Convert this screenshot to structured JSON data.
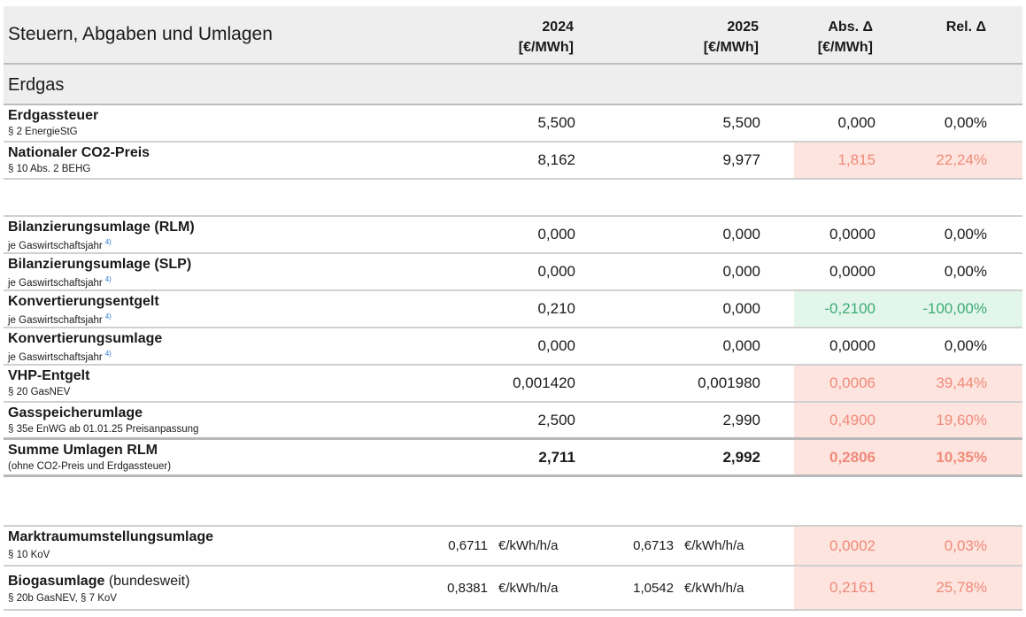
{
  "header": {
    "title": "Steuern, Abgaben und Umlagen",
    "col2024": [
      "2024",
      "[€/MWh]"
    ],
    "col2025": [
      "2025",
      "[€/MWh]"
    ],
    "colAbs": [
      "Abs. Δ",
      "[€/MWh]"
    ],
    "colRel": "Rel. Δ"
  },
  "section": {
    "title": "Erdgas"
  },
  "rows": [
    {
      "label": "Erdgassteuer",
      "sub": "§ 2 EnergieStG",
      "v2024": "5,500",
      "v2025": "5,500",
      "abs": "0,000",
      "rel": "0,00%",
      "tone": "none"
    },
    {
      "label": "Nationaler CO2-Preis",
      "sub": "§ 10 Abs. 2 BEHG",
      "v2024": "8,162",
      "v2025": "9,977",
      "abs": "1,815",
      "rel": "22,24%",
      "tone": "pink"
    },
    {
      "label": "Bilanzierungsumlage (RLM)",
      "sub": "je Gaswirtschaftsjahr",
      "sup": "4)",
      "v2024": "0,000",
      "v2025": "0,000",
      "abs": "0,0000",
      "rel": "0,00%",
      "tone": "none"
    },
    {
      "label": "Bilanzierungsumlage (SLP)",
      "sub": "je Gaswirtschaftsjahr",
      "sup": "4)",
      "v2024": "0,000",
      "v2025": "0,000",
      "abs": "0,0000",
      "rel": "0,00%",
      "tone": "none"
    },
    {
      "label": "Konvertierungsentgelt",
      "sub": "je Gaswirtschaftsjahr",
      "sup": "4)",
      "v2024": "0,210",
      "v2025": "0,000",
      "abs": "-0,2100",
      "rel": "-100,00%",
      "tone": "green"
    },
    {
      "label": "Konvertierungsumlage",
      "sub": "je Gaswirtschaftsjahr",
      "sup": "4)",
      "v2024": "0,000",
      "v2025": "0,000",
      "abs": "0,0000",
      "rel": "0,00%",
      "tone": "none"
    },
    {
      "label": "VHP-Entgelt",
      "sub": "§ 20 GasNEV",
      "v2024": "0,001420",
      "v2025": "0,001980",
      "abs": "0,0006",
      "rel": "39,44%",
      "tone": "pink"
    },
    {
      "label": "Gasspeicherumlage",
      "sub": "§ 35e EnWG ab 01.01.25 Preisanpassung",
      "v2024": "2,500",
      "v2025": "2,990",
      "abs": "0,4900",
      "rel": "19,60%",
      "tone": "pink"
    },
    {
      "label": "Summe Umlagen RLM",
      "sub": "(ohne CO2-Preis und Erdgassteuer)",
      "v2024": "2,711",
      "v2025": "2,992",
      "abs": "0,2806",
      "rel": "10,35%",
      "tone": "pink"
    },
    {
      "label": "Marktraumumstellungsumlage",
      "sub": "§ 10 KoV",
      "v2024": "0,6711",
      "u2024": "€/kWh/h/a",
      "v2025": "0,6713",
      "u2025": "€/kWh/h/a",
      "abs": "0,0002",
      "rel": "0,03%",
      "tone": "pink"
    },
    {
      "label": "Biogasumlage",
      "labelExtra": "(bundesweit)",
      "sub": "§ 20b GasNEV, § 7 KoV",
      "v2024": "0,8381",
      "u2024": "€/kWh/h/a",
      "v2025": "1,0542",
      "u2025": "€/kWh/h/a",
      "abs": "0,2161",
      "rel": "25,78%",
      "tone": "pink"
    }
  ]
}
